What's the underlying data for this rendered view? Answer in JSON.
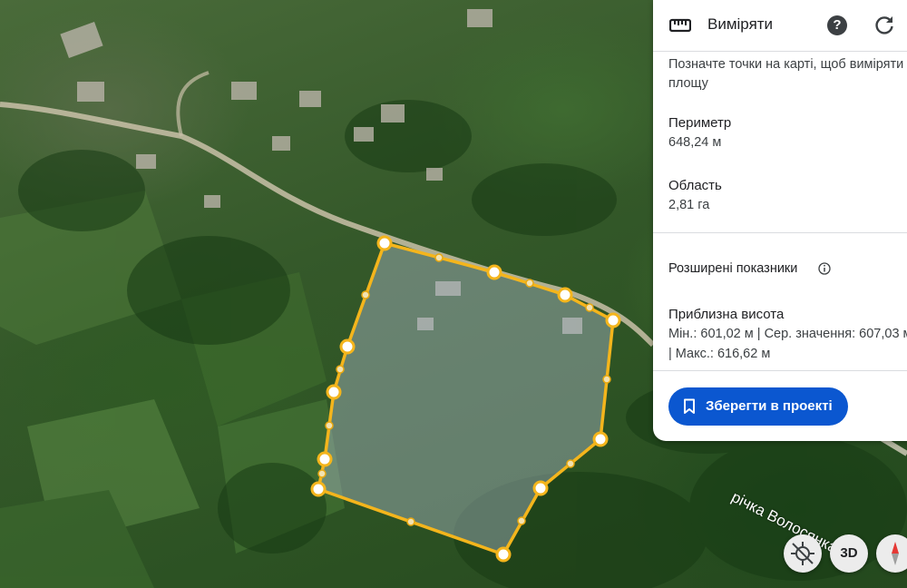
{
  "panel": {
    "title": "Виміряти",
    "help_label": "?",
    "hint_line1": "Позначте точки на карті, щоб виміряти",
    "hint_line2": "площу",
    "perimeter_label": "Периметр",
    "perimeter_value": "648,24 м",
    "area_label": "Область",
    "area_value": "2,81 га",
    "advanced_label": "Розширені показники",
    "elevation_label": "Приблизна висота",
    "elevation_line1": "Мін.: 601,02 м | Сер. значення: 607,03 м",
    "elevation_line2": "| Макс.: 616,62 м",
    "save_label": "Зберегти в проекті"
  },
  "map": {
    "river_label": "річка Волосянка",
    "polygon_color": "#f4b51c",
    "three_d_label": "3D"
  },
  "colors": {
    "accent": "#0b57d0",
    "polygon": "#f4b51c",
    "compass_red": "#e53935"
  },
  "icons": [
    "ruler-icon",
    "help-icon",
    "refresh-icon",
    "info-icon",
    "bookmark-icon",
    "location-off-icon",
    "compass-icon"
  ]
}
